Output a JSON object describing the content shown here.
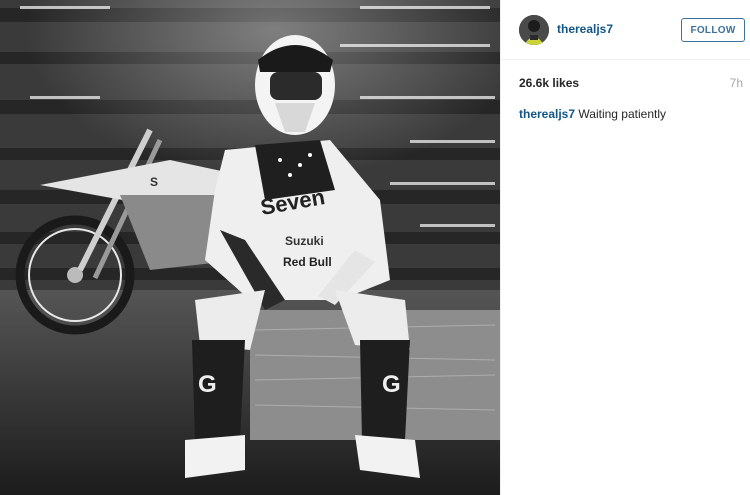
{
  "post": {
    "username": "therealjs7",
    "follow_label": "FOLLOW",
    "likes": "26.6k likes",
    "time": "7h",
    "caption_user": "therealjs7",
    "caption_text": "Waiting patiently"
  },
  "photo": {
    "description_icon": "motocross-photo",
    "gear_text": [
      "Seven",
      "Suzuki",
      "Red Bull"
    ]
  },
  "colors": {
    "link": "#125688",
    "follow": "#3f729b",
    "muted": "#a5a7aa",
    "text": "#262626"
  }
}
